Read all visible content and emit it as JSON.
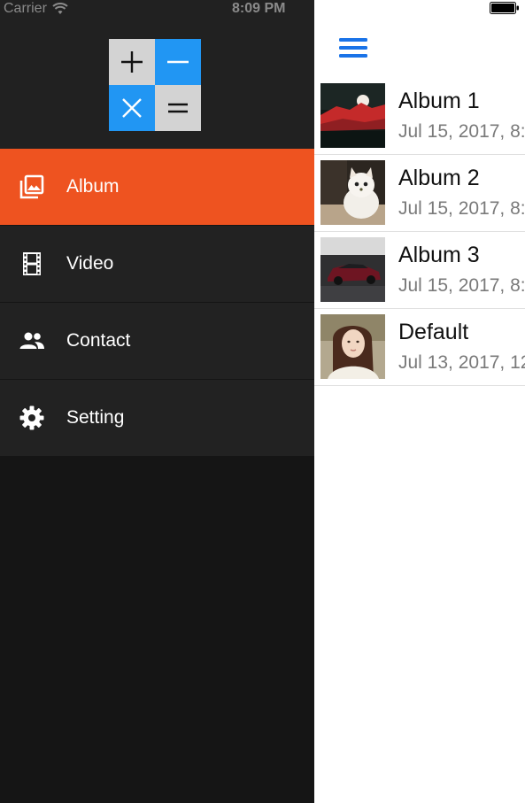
{
  "status_bar": {
    "carrier": "Carrier",
    "time": "8:09 PM"
  },
  "logo": {
    "tiles": [
      "plus-icon",
      "minus-icon",
      "times-icon",
      "equals-icon"
    ],
    "colors": {
      "gray": "#d3d3d3",
      "blue": "#2196f3"
    }
  },
  "drawer": {
    "active_color": "#ee5320",
    "items": [
      {
        "label": "Album",
        "icon": "photo-album-icon",
        "active": true
      },
      {
        "label": "Video",
        "icon": "film-icon",
        "active": false
      },
      {
        "label": "Contact",
        "icon": "people-icon",
        "active": false
      },
      {
        "label": "Setting",
        "icon": "gear-icon",
        "active": false
      }
    ]
  },
  "nav": {
    "menu_icon": "hamburger-icon",
    "accent": "#1a73e8"
  },
  "albums": [
    {
      "title": "Album 1",
      "date": "Jul 15, 2017, 8:",
      "thumbnail": "red-mountain-sunset"
    },
    {
      "title": "Album 2",
      "date": "Jul 15, 2017, 8:",
      "thumbnail": "white-kitten"
    },
    {
      "title": "Album 3",
      "date": "Jul 15, 2017, 8:",
      "thumbnail": "dark-red-car"
    },
    {
      "title": "Default",
      "date": "Jul 13, 2017, 12",
      "thumbnail": "girl-portrait"
    }
  ]
}
